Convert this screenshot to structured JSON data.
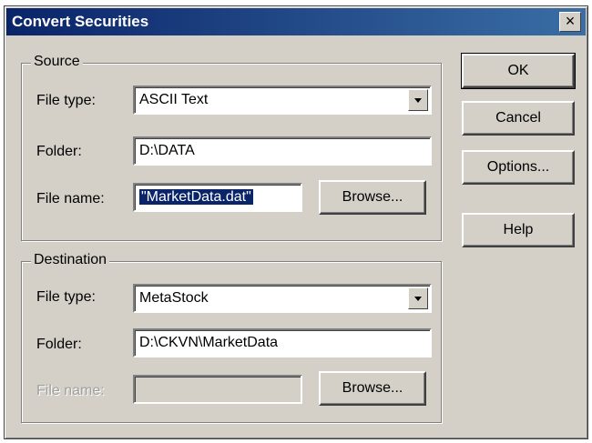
{
  "window": {
    "title": "Convert Securities",
    "close_symbol": "×"
  },
  "source": {
    "legend": "Source",
    "file_type_label": "File type:",
    "file_type_value": "ASCII Text",
    "folder_label": "Folder:",
    "folder_value": "D:\\DATA",
    "file_name_label": "File name:",
    "file_name_value": "\"MarketData.dat\"",
    "browse_label": "Browse..."
  },
  "destination": {
    "legend": "Destination",
    "file_type_label": "File type:",
    "file_type_value": "MetaStock",
    "folder_label": "Folder:",
    "folder_value": "D:\\CKVN\\MarketData",
    "file_name_label": "File name:",
    "file_name_value": "",
    "browse_label": "Browse..."
  },
  "buttons": {
    "ok": "OK",
    "cancel": "Cancel",
    "options": "Options...",
    "help": "Help"
  }
}
